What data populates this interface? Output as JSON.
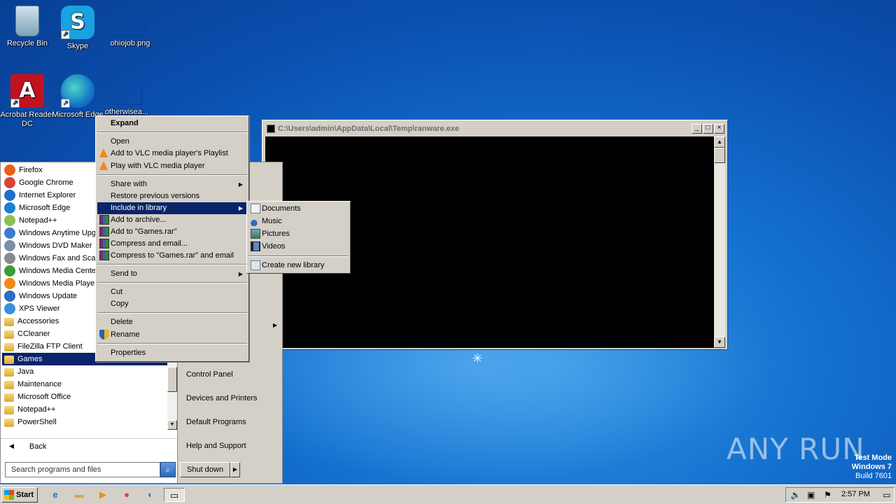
{
  "desktop": {
    "icons": [
      {
        "label": "Recycle Bin",
        "icon": "recycle-bin-icon"
      },
      {
        "label": "Skype",
        "icon": "skype-icon"
      },
      {
        "label": "ohiojob.png",
        "icon": "image-file-icon"
      },
      {
        "label": "Acrobat Reader DC",
        "icon": "acrobat-icon"
      },
      {
        "label": "Microsoft Edge",
        "icon": "edge-icon"
      },
      {
        "label": "otherwisea...",
        "icon": "file-icon"
      }
    ]
  },
  "console": {
    "title": "C:\\Users\\admin\\AppData\\Local\\Temp\\ranware.exe",
    "buttons": {
      "min": "_",
      "max": "□",
      "close": "×"
    }
  },
  "start_menu": {
    "programs": [
      {
        "label": "Firefox",
        "icon": "firefox-icon",
        "color": "#e8601c"
      },
      {
        "label": "Google Chrome",
        "icon": "chrome-icon",
        "color": "#db4437"
      },
      {
        "label": "Internet Explorer",
        "icon": "ie-icon",
        "color": "#1e6fd0"
      },
      {
        "label": "Microsoft Edge",
        "icon": "edge-icon",
        "color": "#1c7fcf"
      },
      {
        "label": "Notepad++",
        "icon": "notepad-icon",
        "color": "#8cc152"
      },
      {
        "label": "Windows Anytime Upgrade",
        "icon": "windows-icon",
        "color": "#3a7bd5"
      },
      {
        "label": "Windows DVD Maker",
        "icon": "dvd-icon",
        "color": "#7a8ea8"
      },
      {
        "label": "Windows Fax and Scan",
        "icon": "fax-icon",
        "color": "#8a8a8a"
      },
      {
        "label": "Windows Media Center",
        "icon": "media-center-icon",
        "color": "#3d9a3a"
      },
      {
        "label": "Windows Media Player",
        "icon": "media-player-icon",
        "color": "#f08a12"
      },
      {
        "label": "Windows Update",
        "icon": "update-icon",
        "color": "#2b6cc4"
      },
      {
        "label": "XPS Viewer",
        "icon": "xps-icon",
        "color": "#3a8fd8"
      },
      {
        "label": "Accessories",
        "icon": "folder-icon"
      },
      {
        "label": "CCleaner",
        "icon": "folder-icon"
      },
      {
        "label": "FileZilla FTP Client",
        "icon": "folder-icon"
      },
      {
        "label": "Games",
        "icon": "folder-icon",
        "selected": true
      },
      {
        "label": "Java",
        "icon": "folder-icon"
      },
      {
        "label": "Maintenance",
        "icon": "folder-icon"
      },
      {
        "label": "Microsoft Office",
        "icon": "folder-icon"
      },
      {
        "label": "Notepad++",
        "icon": "folder-icon"
      },
      {
        "label": "PowerShell",
        "icon": "folder-icon"
      }
    ],
    "back_label": "Back",
    "search_placeholder": "Search programs and files",
    "right_links": [
      "Control Panel",
      "Devices and Printers",
      "Default Programs",
      "Help and Support"
    ],
    "shutdown_label": "Shut down"
  },
  "context_menu": {
    "items": [
      {
        "label": "Expand",
        "bold": true
      },
      {
        "label": "Open"
      },
      {
        "label": "Add to VLC media player's Playlist",
        "icon": "vlc-icon"
      },
      {
        "label": "Play with VLC media player",
        "icon": "vlc-icon"
      },
      {
        "label": "Share with",
        "submenu": true
      },
      {
        "label": "Restore previous versions"
      },
      {
        "label": "Include in library",
        "submenu": true,
        "highlighted": true
      },
      {
        "label": "Add to archive...",
        "icon": "winrar-icon"
      },
      {
        "label": "Add to \"Games.rar\"",
        "icon": "winrar-icon"
      },
      {
        "label": "Compress and email...",
        "icon": "winrar-icon"
      },
      {
        "label": "Compress to \"Games.rar\" and email",
        "icon": "winrar-icon"
      },
      {
        "label": "Send to",
        "submenu": true
      },
      {
        "label": "Cut"
      },
      {
        "label": "Copy"
      },
      {
        "label": "Delete"
      },
      {
        "label": "Rename",
        "icon": "uac-shield-icon"
      },
      {
        "label": "Properties"
      }
    ]
  },
  "library_submenu": {
    "items": [
      {
        "label": "Documents",
        "icon": "documents-library-icon"
      },
      {
        "label": "Music",
        "icon": "music-library-icon"
      },
      {
        "label": "Pictures",
        "icon": "pictures-library-icon"
      },
      {
        "label": "Videos",
        "icon": "videos-library-icon"
      },
      {
        "label": "Create new library",
        "icon": "new-library-icon"
      }
    ]
  },
  "taskbar": {
    "start_label": "Start",
    "pinned": [
      "ie-icon",
      "explorer-icon",
      "media-player-icon",
      "chrome-icon",
      "edge-icon",
      "console-app-icon"
    ],
    "clock": "2:57 PM"
  },
  "watermark": {
    "text": "ANY RUN"
  },
  "test_mode": {
    "line1": "Test Mode",
    "line2": "Windows 7",
    "line3": "Build 7601"
  }
}
